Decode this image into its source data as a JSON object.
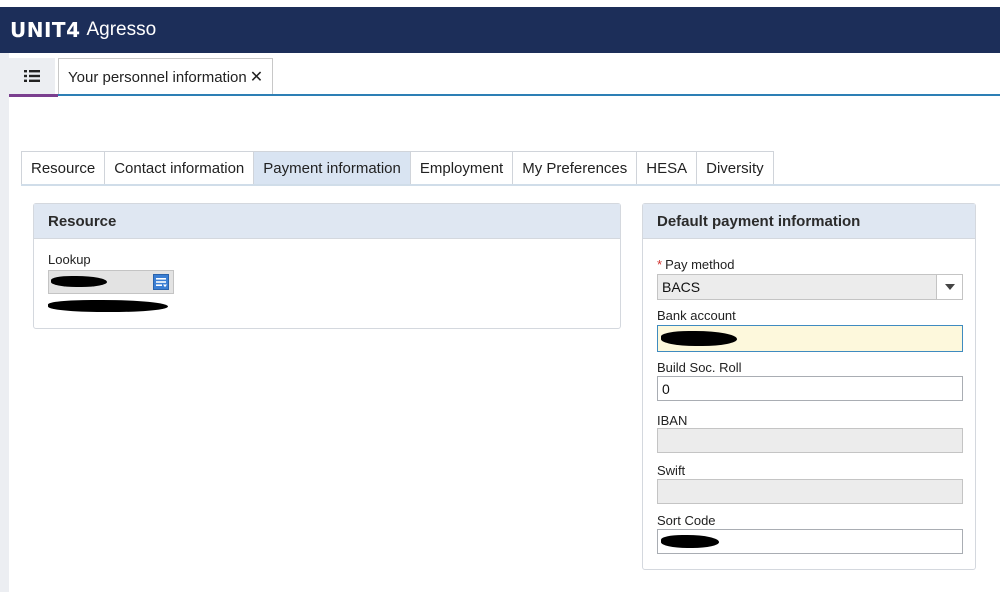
{
  "header": {
    "logo": "UNIT4",
    "product": "Agresso"
  },
  "tabs": {
    "menu_icon": "list-menu-icon",
    "document_tab": "Your personnel information",
    "close_glyph": "✕"
  },
  "section_tabs": [
    {
      "label": "Resource",
      "active": false
    },
    {
      "label": "Contact information",
      "active": false
    },
    {
      "label": "Payment information",
      "active": true
    },
    {
      "label": "Employment",
      "active": false
    },
    {
      "label": "My Preferences",
      "active": false
    },
    {
      "label": "HESA",
      "active": false
    },
    {
      "label": "Diversity",
      "active": false
    }
  ],
  "resource_panel": {
    "title": "Resource",
    "lookup_label": "Lookup",
    "lookup_icon": "lookup-list-icon"
  },
  "payment_panel": {
    "title": "Default payment information",
    "required_marker": "*",
    "pay_method_label": "Pay method",
    "pay_method_value": "BACS",
    "bank_account_label": "Bank account",
    "build_soc_label": "Build Soc. Roll",
    "build_soc_value": "0",
    "iban_label": "IBAN",
    "iban_value": "",
    "swift_label": "Swift",
    "swift_value": "",
    "sort_code_label": "Sort Code"
  },
  "colors": {
    "header_bg": "#1c2e59",
    "active_tab_bg": "#d9e4f2",
    "panel_header_bg": "#dfe7f2",
    "focused_input_bg": "#fdf8dc",
    "accent_blue": "#2d7fb5",
    "accent_purple": "#7b3f8f"
  }
}
